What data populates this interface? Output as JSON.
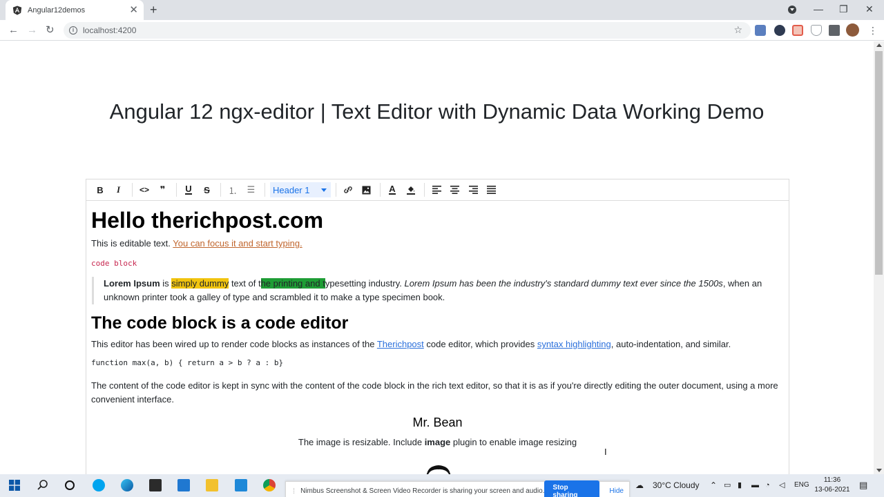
{
  "browser": {
    "tab": {
      "title": "Angular12demos",
      "close_glyph": "✕"
    },
    "newtab_glyph": "+",
    "window": {
      "minimize": "—",
      "restore": "❐",
      "close": "✕"
    },
    "nav": {
      "back": "←",
      "forward": "→",
      "reload": "↻"
    },
    "address": {
      "info_glyph": "i",
      "url": "localhost:4200",
      "star": "☆"
    },
    "menu_glyph": "⋮"
  },
  "page": {
    "title": "Angular 12 ngx-editor | Text Editor with Dynamic Data Working Demo"
  },
  "editor": {
    "menu": {
      "bold": "B",
      "italic": "I",
      "code": "<>",
      "blockquote": "❞",
      "underline": "U",
      "strike": "S",
      "ordered_list": "⒈",
      "bullet_list": "☰",
      "heading_select": "Header 1",
      "link": "🔗",
      "image": "▣",
      "text_color": "A",
      "background_color": "◆",
      "align_left": "≡",
      "align_center": "≡",
      "align_right": "≡",
      "align_justify": "≡"
    },
    "content": {
      "heading1": "Hello therichpost.com",
      "intro": "This is editable text. ",
      "intro_link": "You can focus it and start typing.",
      "code_block": "code block",
      "quote": {
        "bold": "Lorem Ipsum",
        "t1": " is ",
        "highlight_yellow": "simply dummy",
        "t2": " text of t",
        "highlight_green": "he printing and t",
        "t3": "ypesetting industry. ",
        "italic": "Lorem Ipsum has been the industry's standard dummy text ever since the 1500s",
        "t4": ", when an unknown printer took a galley of type and scrambled it to make a type specimen book."
      },
      "heading2": "The code block is a code editor",
      "para1": {
        "t1": "This editor has been wired up to render code blocks as instances of the ",
        "link1": "Therichpost",
        "t2": " code editor, which provides ",
        "link2": "syntax highlighting",
        "t3": ", auto-indentation, and similar."
      },
      "code_line": "function max(a, b) { return a > b ? a : b}",
      "para2": "The content of the code editor is kept in sync with the content of the code block in the rich text editor, so that it is as if you're directly editing the outer document, using a more convenient interface.",
      "heading3": "Mr. Bean",
      "caption": {
        "t1": "The image is resizable. Include ",
        "bold": "image",
        "t2": " plugin to enable image resizing"
      }
    }
  },
  "share_bar": {
    "message": "Nimbus Screenshot & Screen Video Recorder is sharing your screen and audio.",
    "stop_label": "Stop sharing",
    "hide_label": "Hide"
  },
  "taskbar": {
    "weather": "30°C  Cloudy",
    "language": "ENG",
    "time": "11:36",
    "date": "13-06-2021"
  },
  "colors": {
    "highlight_yellow": "#f1c40f",
    "highlight_green": "#1e9d35",
    "link_orange": "#c0652d",
    "link_blue": "#2a6fdb",
    "accent": "#1a73e8"
  }
}
